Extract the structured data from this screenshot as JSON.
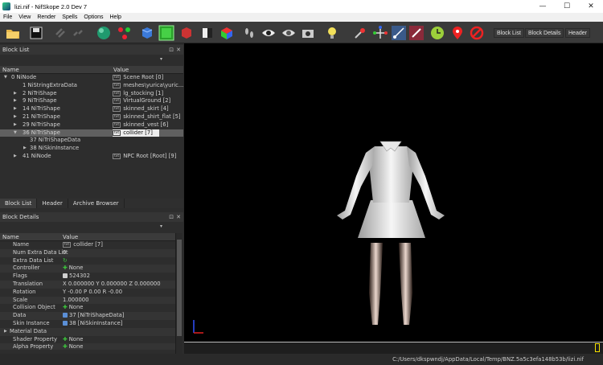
{
  "window": {
    "title": "lizi.nif - NifSkope 2.0 Dev 7",
    "minimize": "—",
    "maximize": "☐",
    "close": "✕"
  },
  "menu": [
    "File",
    "View",
    "Render",
    "Spells",
    "Options",
    "Help"
  ],
  "toolbar": {
    "block_list": "Block List",
    "block_details": "Block Details",
    "header": "Header"
  },
  "block_list": {
    "title": "Block List",
    "col_name": "Name",
    "col_value": "Value",
    "rows": [
      {
        "name": "0 NiNode",
        "value": "Scene Root [0]"
      },
      {
        "name": "1 NiStringExtraData",
        "value": "meshes\\yurica\\yuric..."
      },
      {
        "name": "2 NiTriShape",
        "value": "lg_stocking [1]"
      },
      {
        "name": "9 NiTriShape",
        "value": "VirtualGround [2]"
      },
      {
        "name": "14 NiTriShape",
        "value": "skinned_skirt [4]"
      },
      {
        "name": "21 NiTriShape",
        "value": "skinned_shirt_flat [5]"
      },
      {
        "name": "29 NiTriShape",
        "value": "skinned_vest [6]"
      },
      {
        "name": "36 NiTriShape",
        "value": "collider [7]"
      },
      {
        "name": "37 NiTriShapeData",
        "value": ""
      },
      {
        "name": "38 NiSkinInstance",
        "value": ""
      },
      {
        "name": "41 NiNode",
        "value": "NPC Root [Root] [9]"
      }
    ],
    "tag_txt": "txt"
  },
  "tabs": [
    "Block List",
    "Header",
    "Archive Browser"
  ],
  "block_details": {
    "title": "Block Details",
    "col_name": "Name",
    "col_value": "Value",
    "rows": [
      {
        "name": "Name",
        "value": "collider [7]"
      },
      {
        "name": "Num Extra Data List",
        "value": "0"
      },
      {
        "name": "Extra Data List",
        "value": ""
      },
      {
        "name": "Controller",
        "value": "None"
      },
      {
        "name": "Flags",
        "value": "524302"
      },
      {
        "name": "Translation",
        "value": "X 0.000000 Y 0.000000 Z 0.000000"
      },
      {
        "name": "Rotation",
        "value": "Y -0.00 P 0.00 R -0.00"
      },
      {
        "name": "Scale",
        "value": "1.000000"
      },
      {
        "name": "Collision Object",
        "value": "None"
      },
      {
        "name": "Data",
        "value": "37 [NiTriShapeData]"
      },
      {
        "name": "Skin Instance",
        "value": "38 [NiSkinInstance]"
      },
      {
        "name": "Material Data",
        "value": ""
      },
      {
        "name": "Shader Property",
        "value": "None"
      },
      {
        "name": "Alpha Property",
        "value": "None"
      }
    ]
  },
  "status": {
    "path": "C:/Users/dkspwndj/AppData/Local/Temp/BNZ.5a5c3efa148b53b/lizi.nif"
  },
  "colors": {
    "plus": "#3cc43c",
    "selection": "#606060",
    "viewport": "#000000",
    "timeline_marker": "#f5e000"
  }
}
